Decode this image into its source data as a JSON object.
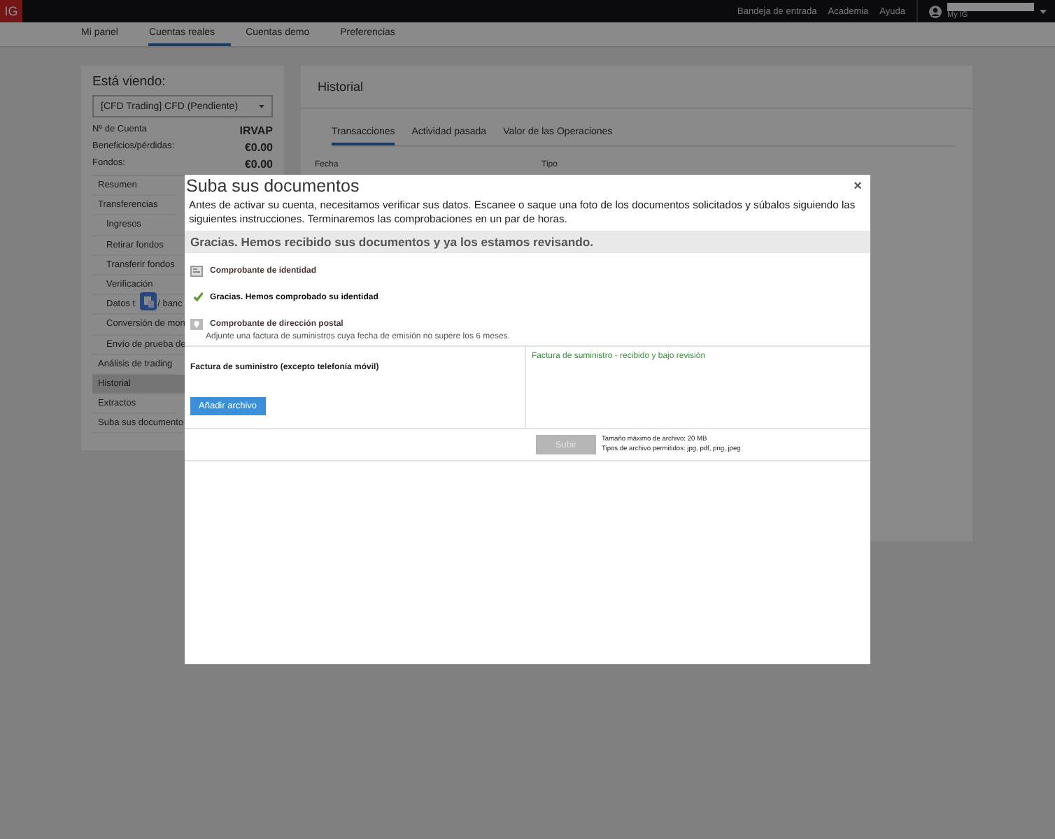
{
  "topbar": {
    "logo": "IG",
    "links": [
      "Bandeja de entrada",
      "Academia",
      "Ayuda"
    ],
    "account": "My IG"
  },
  "nav": [
    {
      "label": "Mi panel",
      "selected": false
    },
    {
      "label": "Cuentas reales",
      "selected": true
    },
    {
      "label": "Cuentas demo",
      "selected": false
    },
    {
      "label": "Preferencias",
      "selected": false
    }
  ],
  "sidebar": {
    "heading": "Está viendo:",
    "account_select": "[CFD Trading] CFD (Pendiente)",
    "stats": [
      {
        "label": "Nº de Cuenta",
        "value": "IRVAP"
      },
      {
        "label": "Beneficios/pérdidas:",
        "value": "€0.00"
      },
      {
        "label": "Fondos:",
        "value": "€0.00"
      }
    ],
    "items": [
      {
        "label": "Resumen",
        "selected": false
      },
      {
        "label": "Transferencias",
        "selected": false,
        "children": [
          {
            "label": "Ingresos",
            "selected": false
          },
          {
            "label": "Retirar fondos",
            "selected": false
          },
          {
            "label": "Transferir fondos",
            "selected": false
          },
          {
            "label": "Verificación",
            "selected": false
          },
          {
            "label": "Datos t",
            "label_2": "/ banc",
            "selected": false
          },
          {
            "label": "Conversión de mon",
            "selected": false
          },
          {
            "label": "Envío de prueba de",
            "selected": false
          }
        ]
      },
      {
        "label": "Análisis de trading",
        "selected": false
      },
      {
        "label": "Historial",
        "selected": true
      },
      {
        "label": "Extractos",
        "selected": false
      },
      {
        "label": "Suba sus documento",
        "selected": false
      }
    ]
  },
  "history": {
    "title": "Historial",
    "tabs": [
      {
        "label": "Transacciones",
        "selected": true
      },
      {
        "label": "Actividad pasada",
        "selected": false
      },
      {
        "label": "Valor de las Operaciones",
        "selected": false
      }
    ],
    "filters": [
      "Fecha",
      "Tipo"
    ]
  },
  "modal": {
    "title": "Suba sus documentos",
    "close": "×",
    "intro": "Antes de activar su cuenta, necesitamos verificar sus datos. Escanee o saque una foto de los documentos solicitados y súbalos siguiendo las siguientes instrucciones. Terminaremos las comprobaciones en un par de horas.",
    "banner": "Gracias. Hemos recibido sus documentos y ya los estamos revisando.",
    "identity": {
      "title": "Comprobante de identidad",
      "verified": true,
      "message": "Gracias. Hemos comprobado su identidad"
    },
    "address": {
      "title": "Comprobante de dirección postal",
      "note": "Adjunte una factura de suministros cuya fecha de emisión no supere los 6 meses.",
      "document": "Factura de suministro (excepto telefonía móvil)",
      "add_button": "Añadir archivo",
      "status": "Factura de suministro - recibido y bajo revisión"
    },
    "upload": {
      "label": "Subir",
      "disabled": true,
      "info": [
        "Tamaño máximo de archivo: 20 MB",
        "Tipos de archivo permitidos: jpg, pdf, png, jpeg"
      ]
    }
  }
}
